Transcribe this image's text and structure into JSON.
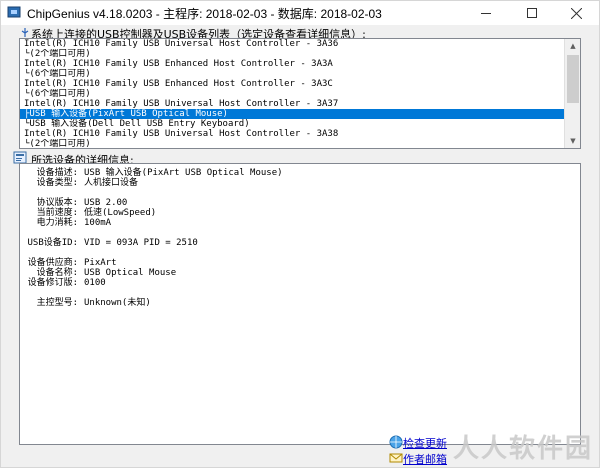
{
  "window": {
    "title": "ChipGenius v4.18.0203 - 主程序: 2018-02-03 - 数据库: 2018-02-03"
  },
  "device_list": {
    "label": "系统上连接的USB控制器及USB设备列表（选定设备查看详细信息）:",
    "items": [
      "Intel(R) ICH10 Family USB Universal Host Controller - 3A36",
      "  └(2个端口可用)",
      "Intel(R) ICH10 Family USB Enhanced Host Controller - 3A3A",
      "  └(6个端口可用)",
      "Intel(R) ICH10 Family USB Enhanced Host Controller - 3A3C",
      "  └(6个端口可用)",
      "Intel(R) ICH10 Family USB Universal Host Controller - 3A37",
      "  ├USB 输入设备(PixArt USB Optical Mouse)",
      "  └USB 输入设备(Dell Dell USB Entry Keyboard)",
      "Intel(R) ICH10 Family USB Universal Host Controller - 3A38",
      "  └(2个端口可用)"
    ],
    "selected_index": 7
  },
  "details": {
    "label": "所选设备的详细信息:",
    "rows": [
      {
        "key": "设备描述:",
        "value": "USB 输入设备(PixArt USB Optical Mouse)"
      },
      {
        "key": "设备类型:",
        "value": "人机接口设备"
      },
      {
        "key": "",
        "value": ""
      },
      {
        "key": "协议版本:",
        "value": "USB 2.00"
      },
      {
        "key": "当前速度:",
        "value": "低速(LowSpeed)"
      },
      {
        "key": "电力消耗:",
        "value": "100mA"
      },
      {
        "key": "",
        "value": ""
      },
      {
        "key": "USB设备ID:",
        "value": "VID = 093A PID = 2510"
      },
      {
        "key": "",
        "value": ""
      },
      {
        "key": "设备供应商:",
        "value": "PixArt"
      },
      {
        "key": "设备名称:",
        "value": "USB Optical Mouse"
      },
      {
        "key": "设备修订版:",
        "value": "0100"
      },
      {
        "key": "",
        "value": ""
      },
      {
        "key": "主控型号:",
        "value": "Unknown(未知)"
      }
    ]
  },
  "links": {
    "check_update": "检查更新",
    "author_mail": "作者邮箱"
  },
  "watermark": "人人软件园",
  "colors": {
    "selection": "#0078d7",
    "link": "#0000cc"
  }
}
